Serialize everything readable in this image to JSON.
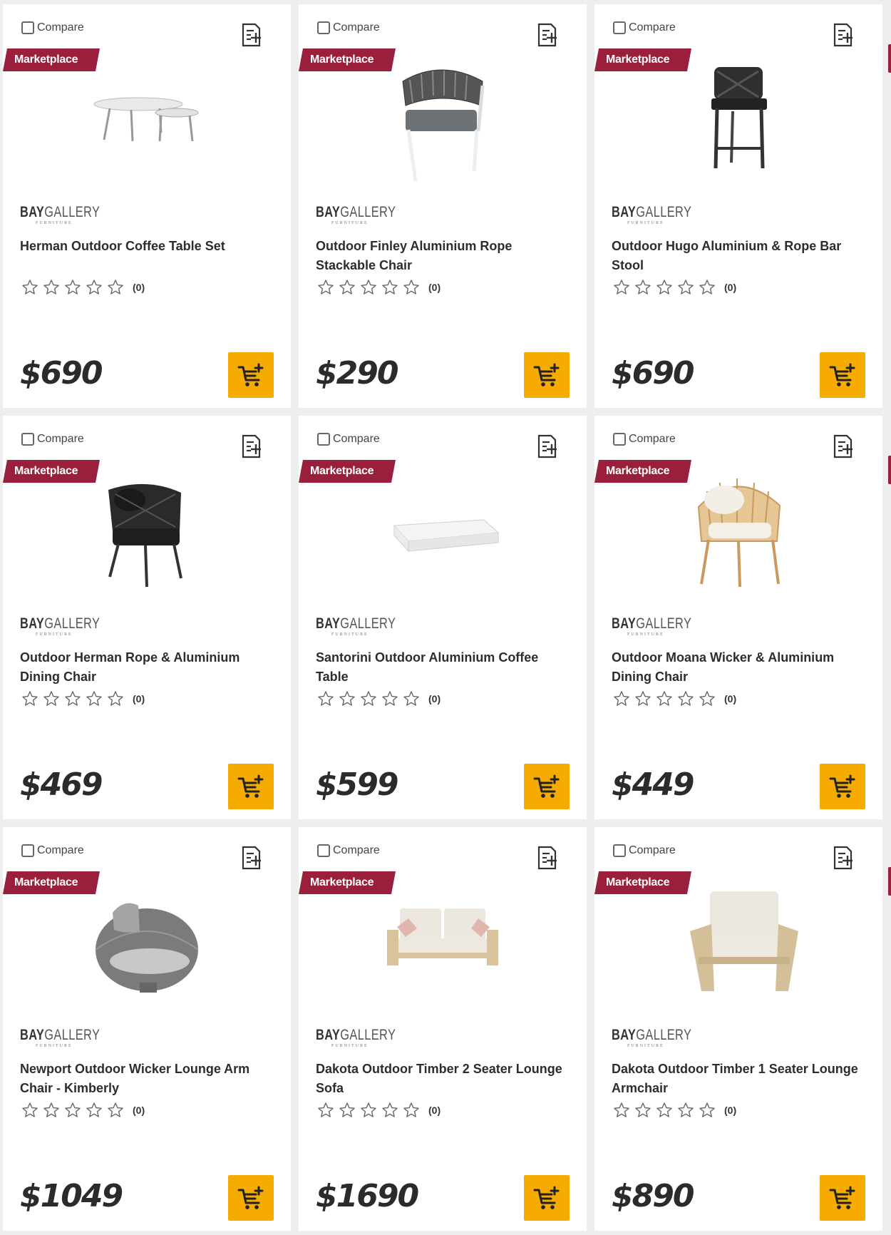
{
  "colors": {
    "badge": "#9a1f3c",
    "cart": "#f6ab00",
    "card_bg": "#ffffff",
    "page_bg": "#eeeeee"
  },
  "common": {
    "compare_label": "Compare",
    "badge_label": "Marketplace",
    "brand_main": "BAY",
    "brand_accent": "GALLERY",
    "brand_sub": "FURNITURE"
  },
  "products": [
    {
      "title": "Herman Outdoor Coffee Table Set",
      "rating_count": "(0)",
      "stars": 0,
      "price": "$690",
      "image": "coffee-table-set"
    },
    {
      "title": "Outdoor Finley Aluminium Rope Stackable Chair",
      "rating_count": "(0)",
      "stars": 0,
      "price": "$290",
      "image": "rope-chair"
    },
    {
      "title": "Outdoor Hugo Aluminium & Rope Bar Stool",
      "rating_count": "(0)",
      "stars": 0,
      "price": "$690",
      "image": "bar-stool"
    },
    {
      "title": "Outdoor Herman Rope & Aluminium Dining Chair",
      "rating_count": "(0)",
      "stars": 0,
      "price": "$469",
      "image": "black-dining-chair"
    },
    {
      "title": "Santorini Outdoor Aluminium Coffee Table",
      "rating_count": "(0)",
      "stars": 0,
      "price": "$599",
      "image": "white-coffee-table"
    },
    {
      "title": "Outdoor Moana Wicker & Aluminium Dining Chair",
      "rating_count": "(0)",
      "stars": 0,
      "price": "$449",
      "image": "wicker-chair"
    },
    {
      "title": "Newport Outdoor Wicker Lounge Arm Chair - Kimberly",
      "rating_count": "(0)",
      "stars": 0,
      "price": "$1049",
      "image": "round-lounge-chair"
    },
    {
      "title": "Dakota Outdoor Timber 2 Seater Lounge Sofa",
      "rating_count": "(0)",
      "stars": 0,
      "price": "$1690",
      "image": "timber-sofa"
    },
    {
      "title": "Dakota Outdoor Timber 1 Seater Lounge Armchair",
      "rating_count": "(0)",
      "stars": 0,
      "price": "$890",
      "image": "timber-armchair"
    }
  ]
}
